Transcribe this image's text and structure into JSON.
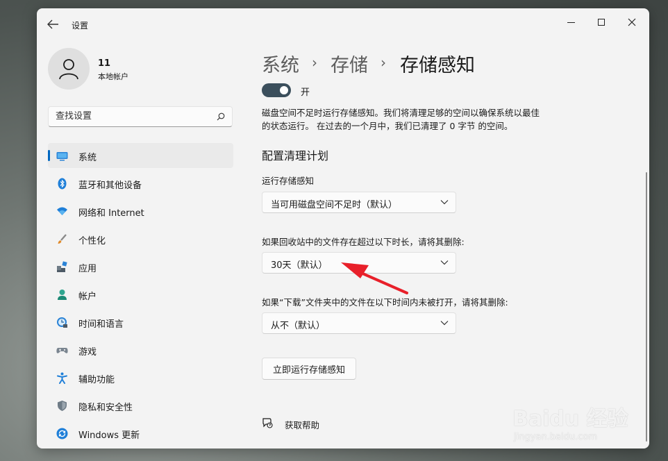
{
  "window": {
    "title": "设置"
  },
  "user": {
    "name": "11",
    "account_type": "本地帐户"
  },
  "search": {
    "placeholder": "查找设置"
  },
  "nav": {
    "items": [
      {
        "label": "系统",
        "icon": "monitor-icon",
        "active": true
      },
      {
        "label": "蓝牙和其他设备",
        "icon": "bluetooth-icon"
      },
      {
        "label": "网络和 Internet",
        "icon": "wifi-icon"
      },
      {
        "label": "个性化",
        "icon": "brush-icon"
      },
      {
        "label": "应用",
        "icon": "apps-icon"
      },
      {
        "label": "帐户",
        "icon": "person-icon"
      },
      {
        "label": "时间和语言",
        "icon": "globe-clock-icon"
      },
      {
        "label": "游戏",
        "icon": "gamepad-icon"
      },
      {
        "label": "辅助功能",
        "icon": "accessibility-icon"
      },
      {
        "label": "隐私和安全性",
        "icon": "shield-icon"
      },
      {
        "label": "Windows 更新",
        "icon": "update-icon"
      }
    ]
  },
  "breadcrumb": {
    "level1": "系统",
    "level2": "存储",
    "current": "存储感知",
    "separator": "›"
  },
  "toggle": {
    "label": "开",
    "state": "on"
  },
  "description": {
    "line1": "磁盘空间不足时运行存储感知。我们将清理足够的空间以确保系统以最佳",
    "line2": "的状态运行。 在过去的一个月中，我们已清理了 0 字节 的空间。"
  },
  "section": {
    "title": "配置清理计划"
  },
  "settings": {
    "run_label": "运行存储感知",
    "run_value": "当可用磁盘空间不足时（默认）",
    "recycle_label": "如果回收站中的文件存在超过以下时长，请将其删除:",
    "recycle_value": "30天（默认）",
    "downloads_label": "如果“下载”文件夹中的文件在以下时间内未被打开，请将其删除:",
    "downloads_value": "从不（默认）"
  },
  "run_now_button": "立即运行存储感知",
  "help": {
    "label": "获取帮助"
  },
  "watermark": {
    "line1": "Baidu 经验",
    "line2": "jingyan.baidu.com"
  },
  "colors": {
    "accent": "#0067c0",
    "toggle_on": "#3b4f5c",
    "arrow": "#e8202a"
  }
}
